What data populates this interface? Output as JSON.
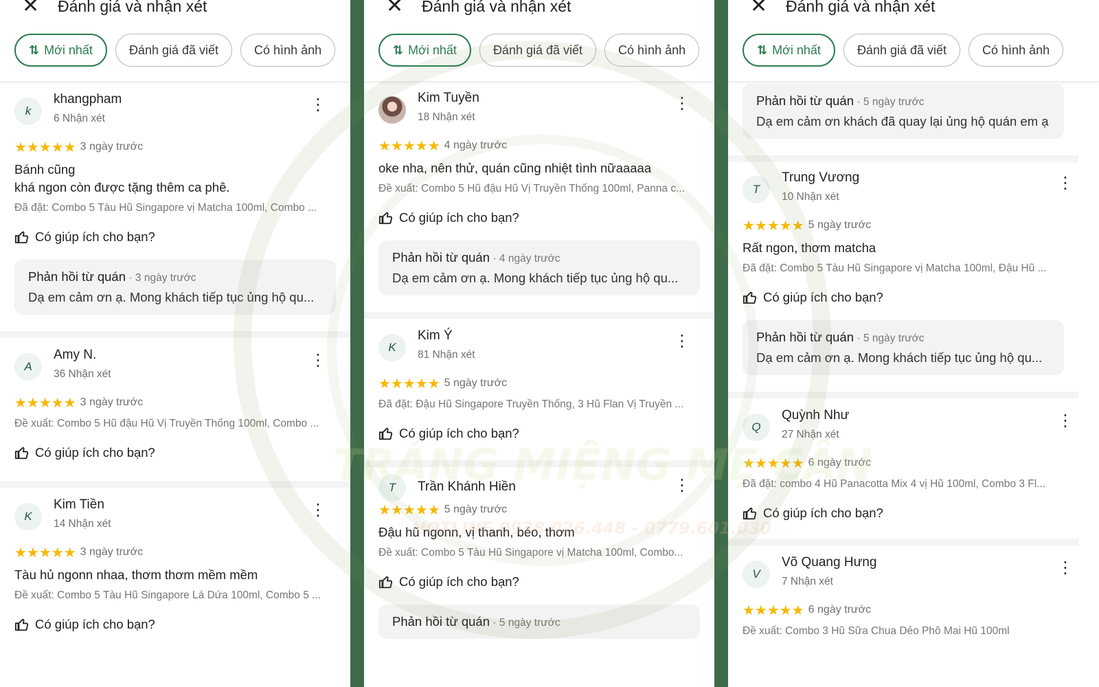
{
  "header": {
    "title": "Đánh giá và nhận xét",
    "chips": [
      "Mới nhất",
      "Đánh giá đã viết",
      "Có hình ảnh"
    ]
  },
  "helpful_label": "Có giúp ích cho bạn?",
  "reply_label": "Phản hồi từ quán",
  "watermark": {
    "brand": "TRÁNG MIỆNG MẸ CẦN",
    "hotline": "HOTLINE 0938.026.448 - 0779.601.030"
  },
  "panels": [
    {
      "reviews": [
        {
          "avatar": "k",
          "name": "khangpham",
          "meta": "6 Nhận xét",
          "rating": 5,
          "date": "3 ngày trước",
          "text": "Bánh cũng\n khá ngon còn được tặng thêm ca phê.",
          "order": "Đã đặt: Combo 5 Tàu Hũ Singapore vị Matcha 100ml, Combo ...",
          "reply": {
            "date": "· 3 ngày trước",
            "text": "Dạ em cảm ơn ạ. Mong khách tiếp tục ủng hộ qu..."
          }
        },
        {
          "avatar": "A",
          "name": "Amy N.",
          "meta": "36 Nhận xét",
          "rating": 5,
          "date": "3 ngày trước",
          "order": "Đề xuất: Combo 5 Hũ đậu Hũ Vị Truyền Thống 100ml, Combo ..."
        },
        {
          "avatar": "K",
          "name": "Kim Tiền",
          "meta": "14 Nhận xét",
          "rating": 5,
          "date": "3 ngày trước",
          "text": "Tàu hủ ngonn nhaa, thơm thơm mềm mềm",
          "order": "Đề xuất: Combo 5 Tàu Hũ Singapore Lá Dứa 100ml, Combo 5 ..."
        }
      ]
    },
    {
      "reviews": [
        {
          "avatar": "",
          "photo": true,
          "name": "Kim Tuyền",
          "meta": "18 Nhận xét",
          "rating": 5,
          "date": "4 ngày trước",
          "text": "oke nha, nên thử, quán cũng nhiệt tình nữaaaaa",
          "order": "Đề xuất: Combo 5 Hũ đậu Hũ Vị Truyền Thống 100ml, Panna c...",
          "reply": {
            "date": "· 4 ngày trước",
            "text": "Dạ em cảm ơn ạ. Mong khách tiếp tục ủng hộ qu..."
          }
        },
        {
          "avatar": "K",
          "name": "Kim Ý",
          "meta": "81 Nhận xét",
          "rating": 5,
          "date": "5 ngày trước",
          "order": "Đã đặt: Đậu Hũ Singapore Truyền Thống, 3 Hũ Flan Vị Truyền ..."
        },
        {
          "avatar": "T",
          "name": "Trần Khánh Hiền",
          "meta": "",
          "rating": 5,
          "date": "5 ngày trước",
          "text": "Đậu hũ ngonn, vị thanh, béo, thơm",
          "order": "Đề xuất: Combo 5 Tàu Hũ Singapore vị Matcha 100ml, Combo...",
          "reply": {
            "date": "· 5 ngày trước",
            "text": ""
          }
        }
      ]
    },
    {
      "top_reply": {
        "date": "· 5 ngày trước",
        "text": "Dạ em cảm ơn khách đã quay lại ủng hộ quán em ạ"
      },
      "reviews": [
        {
          "avatar": "T",
          "name": "Trung Vương",
          "meta": "10 Nhận xét",
          "rating": 5,
          "date": "5 ngày trước",
          "text": "Rất ngon, thơm matcha",
          "order": "Đã đặt: Combo 5 Tàu Hũ Singapore vị Matcha 100ml, Đậu Hũ ...",
          "reply": {
            "date": "· 5 ngày trước",
            "text": "Dạ em cảm ơn ạ. Mong khách tiếp tục ủng hộ qu..."
          }
        },
        {
          "avatar": "Q",
          "name": "Quỳnh Như",
          "meta": "27 Nhận xét",
          "rating": 5,
          "date": "6 ngày trước",
          "order": "Đã đặt: combo 4 Hũ Panacotta Mix 4 vị Hũ 100ml, Combo 3 Fl..."
        },
        {
          "avatar": "V",
          "name": "Võ Quang Hưng",
          "meta": "7 Nhận xét",
          "rating": 5,
          "date": "6 ngày trước",
          "order": "Đề xuất: Combo 3 Hũ Sữa Chua Dẻo Phô Mai Hũ 100ml"
        }
      ]
    }
  ]
}
